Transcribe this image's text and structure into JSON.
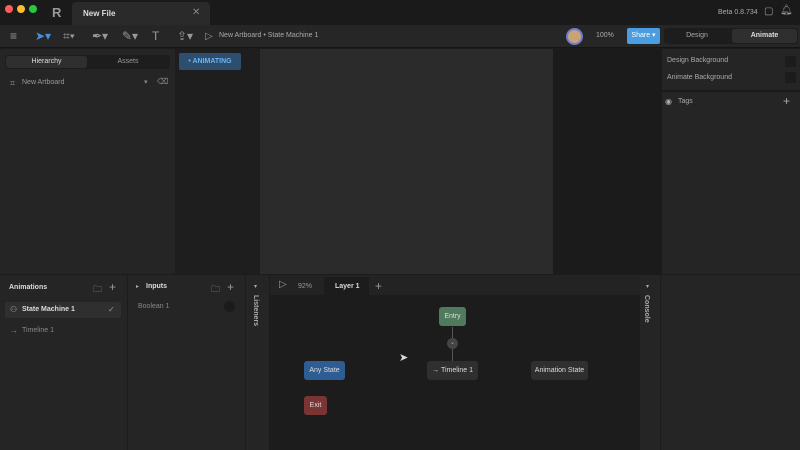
{
  "window": {
    "tab_title": "New File",
    "version": "Beta 0.8.734"
  },
  "toolbar": {
    "breadcrumb": "New Artboard • State Machine 1",
    "zoom": "100%",
    "share": "Share",
    "modes": [
      "Design",
      "Animate"
    ],
    "active_mode": "Animate"
  },
  "left_panel": {
    "tabs": [
      "Hierarchy",
      "Assets"
    ],
    "active_tab": "Hierarchy",
    "artboard": "New Artboard"
  },
  "stage": {
    "badge": "ANIMATING"
  },
  "right_panel": {
    "rows": [
      "Design Background",
      "Animate Background"
    ],
    "tags": "Tags"
  },
  "animations": {
    "title": "Animations",
    "items": [
      {
        "label": "State Machine 1",
        "selected": true
      },
      {
        "label": "Timeline 1"
      }
    ]
  },
  "inputs": {
    "title": "Inputs",
    "items": [
      "Boolean 1"
    ]
  },
  "listeners": "Listeners",
  "console": "Console",
  "graph": {
    "zoom": "92%",
    "layer_tab": "Layer 1",
    "nodes": {
      "entry": "Entry",
      "any_state": "Any State",
      "exit": "Exit",
      "timeline": "Timeline 1",
      "animation_state": "Animation State"
    }
  },
  "colors": {
    "accent": "#4a90d9",
    "entry": "#4f7a5c",
    "any_state": "#2e5d94",
    "exit": "#7a3434"
  }
}
